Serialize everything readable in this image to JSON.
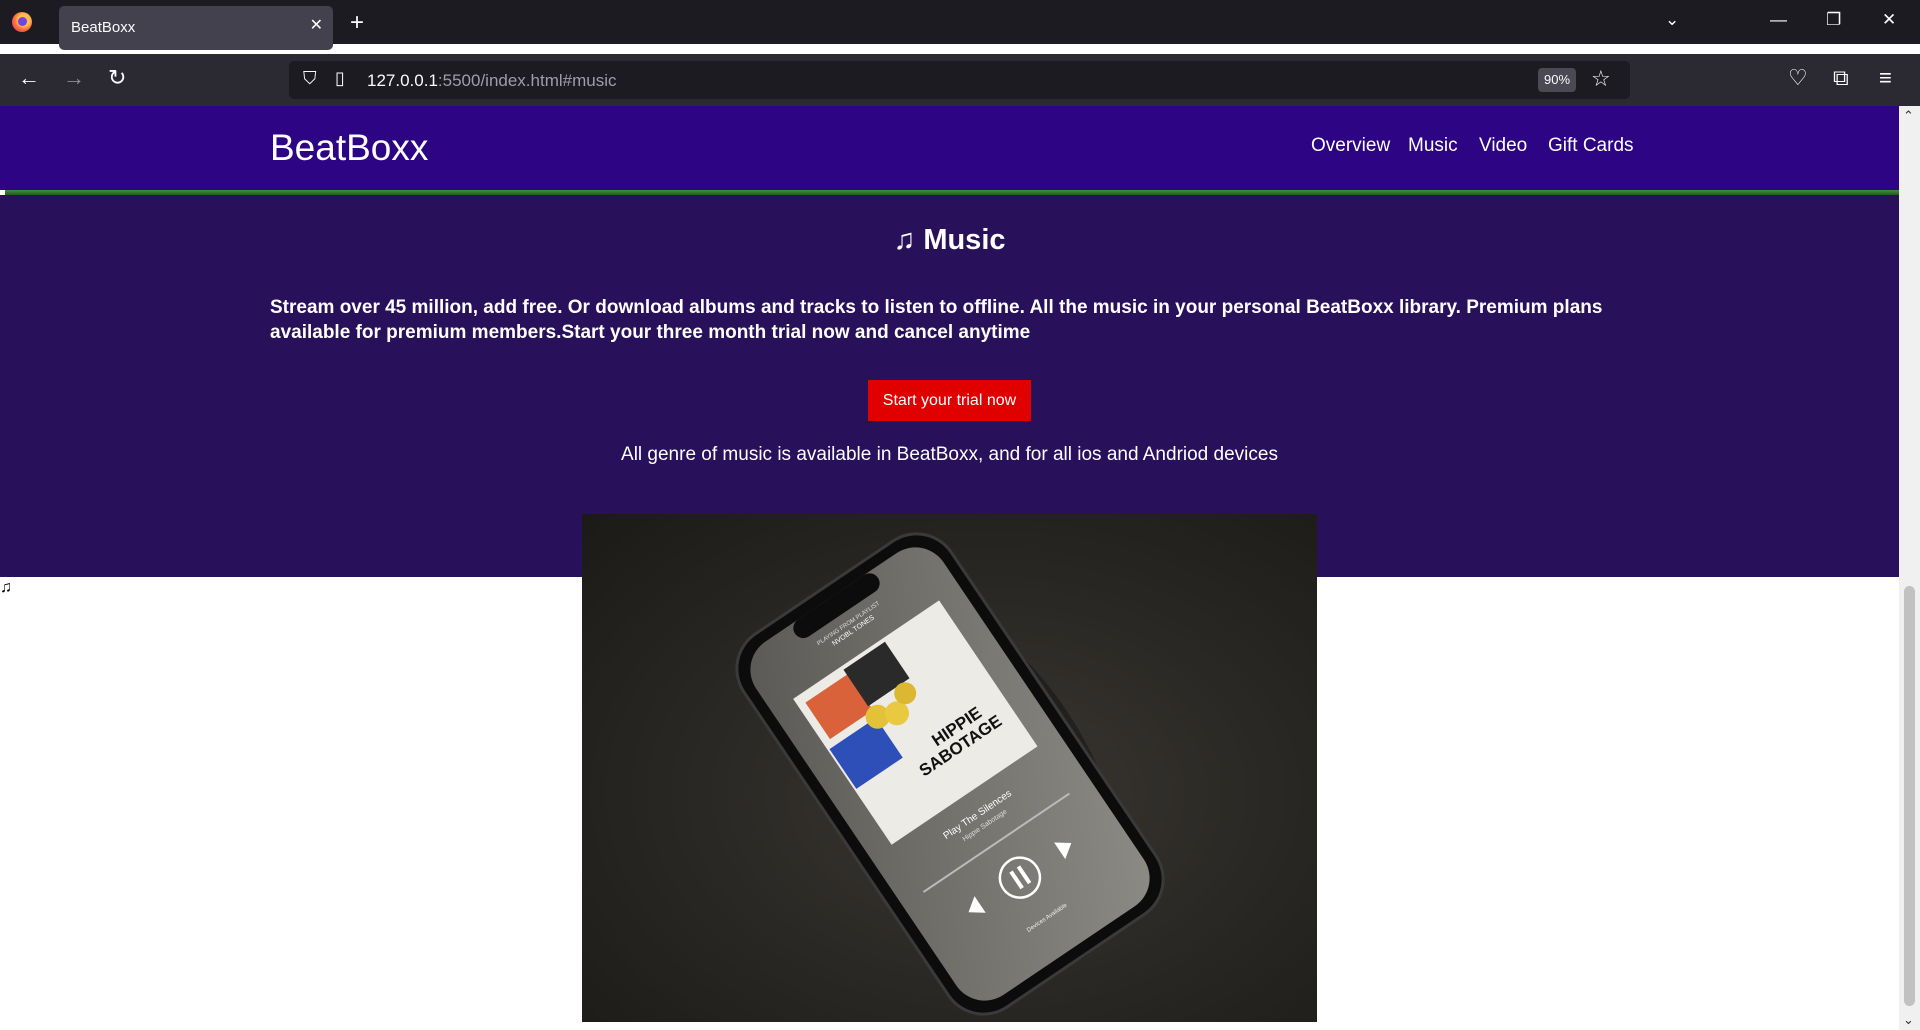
{
  "browser": {
    "tab_title": "BeatBoxx",
    "tab_close": "✕",
    "new_tab": "+",
    "url_host": "127.0.0.1",
    "url_rest": ":5500/index.html#music",
    "zoom": "90%"
  },
  "site": {
    "brand": "BeatBoxx",
    "nav": [
      "Overview",
      "Music",
      "Video",
      "Gift Cards"
    ]
  },
  "music": {
    "icon": "♫",
    "title": "Music",
    "description": "Stream over 45 million, add free. Or download albums and tracks to listen to offline. All the music in your personal BeatBoxx library. Premium plans available for premium members.Start your three month trial now and cancel anytime",
    "cta_label": "Start your trial now",
    "genre_text": "All genre of music is available in BeatBoxx, and for all ios and Andriod devices",
    "stray_note": "♫"
  },
  "phone_screen": {
    "header_small": "PLAYING FROM PLAYLIST",
    "playlist": "NVOBL TONES",
    "album_line1": "HIPPIE",
    "album_line2": "SABOTAGE",
    "track_title": "Play The Silences",
    "artist": "Hippie Sabotage",
    "devices": "Devices Available"
  },
  "colors": {
    "header_bg": "#2c0484",
    "section_bg": "#28105a",
    "cta_bg": "#e00000",
    "accent_line": "#3d9140"
  }
}
